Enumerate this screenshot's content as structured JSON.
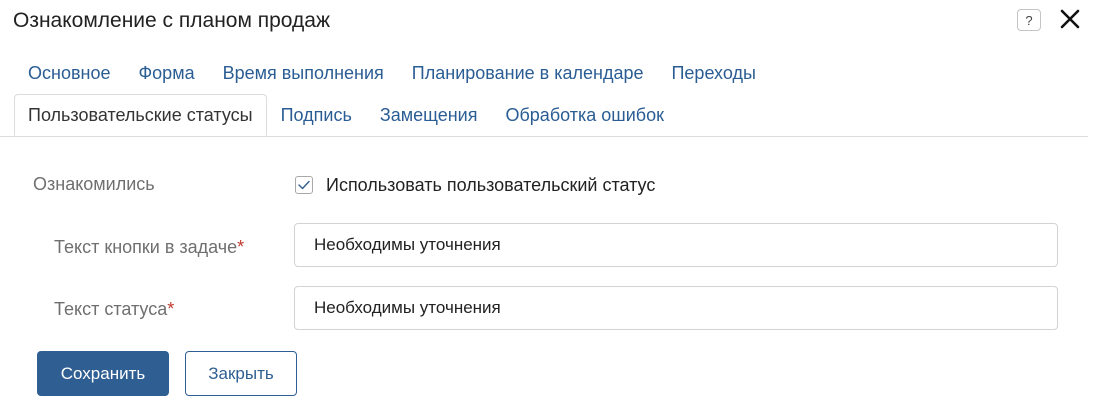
{
  "dialog": {
    "title": "Ознакомление с планом продаж",
    "help_glyph": "?",
    "help_icon": "help-icon",
    "close_icon": "close-icon"
  },
  "tabs": {
    "row1": [
      {
        "label": "Основное",
        "active": false
      },
      {
        "label": "Форма",
        "active": false
      },
      {
        "label": "Время выполнения",
        "active": false
      },
      {
        "label": "Планирование в календаре",
        "active": false
      },
      {
        "label": "Переходы",
        "active": false
      }
    ],
    "row2": [
      {
        "label": "Пользовательские статусы",
        "active": true
      },
      {
        "label": "Подпись",
        "active": false
      },
      {
        "label": "Замещения",
        "active": false
      },
      {
        "label": "Обработка ошибок",
        "active": false
      }
    ]
  },
  "form": {
    "section_label": "Ознакомились",
    "checkbox_label": "Использовать пользовательский статус",
    "checkbox_checked": true,
    "button_text_label": "Текст кнопки в задаче",
    "button_text_value": "Необходимы уточнения",
    "status_text_label": "Текст статуса",
    "status_text_value": "Необходимы уточнения",
    "required_mark": "*"
  },
  "actions": {
    "save_label": "Сохранить",
    "close_label": "Закрыть"
  },
  "colors": {
    "accent": "#2f5f92",
    "link": "#2a5d94",
    "required": "#c0392b"
  }
}
